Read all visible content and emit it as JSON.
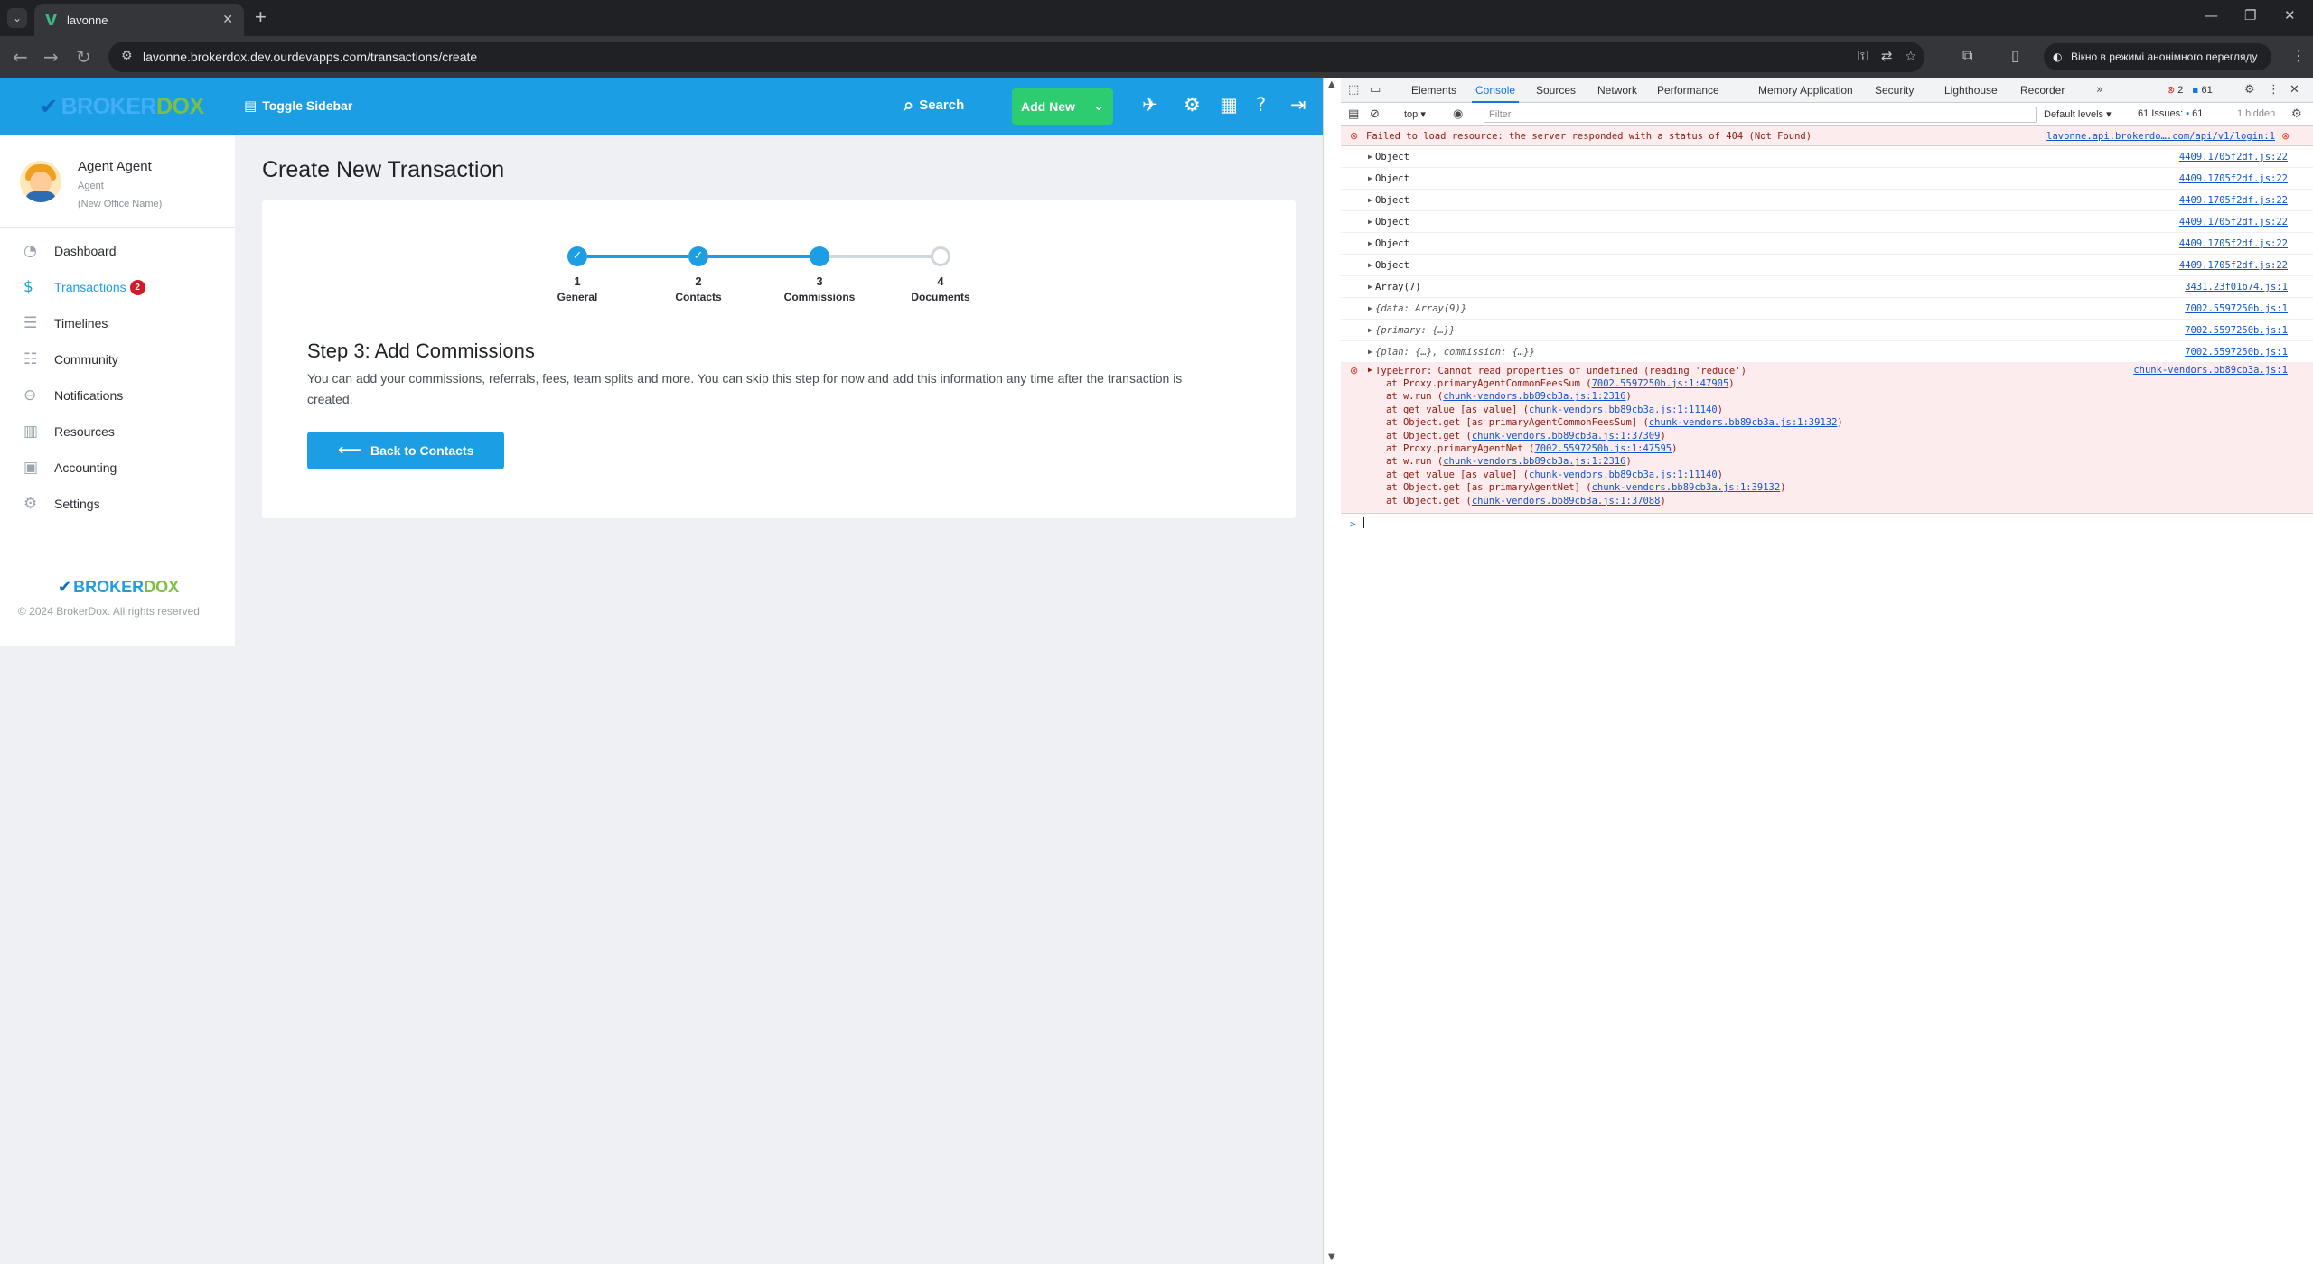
{
  "browser": {
    "tab_title": "lavonne",
    "tab_favicon": "V",
    "tab_close": "✕",
    "new_tab": "+",
    "url": "lavonne.brokerdox.dev.ourdevapps.com/transactions/create",
    "incognito_text": "Вікно в режимі анонімного перегляду"
  },
  "app": {
    "logo_part1": "BROKER",
    "logo_part2": "DOX",
    "toggle_sidebar": "Toggle Sidebar",
    "search": "Search",
    "add_new": "Add New",
    "user": {
      "name": "Agent Agent",
      "role": "Agent",
      "office": "(New Office Name)"
    },
    "menu": [
      {
        "label": "Dashboard",
        "icon": "dashboard-icon"
      },
      {
        "label": "Transactions",
        "icon": "dollar-icon",
        "badge": "2",
        "active": true
      },
      {
        "label": "Timelines",
        "icon": "timeline-icon"
      },
      {
        "label": "Community",
        "icon": "community-icon"
      },
      {
        "label": "Notifications",
        "icon": "notifications-icon"
      },
      {
        "label": "Resources",
        "icon": "resources-icon"
      },
      {
        "label": "Accounting",
        "icon": "accounting-icon"
      },
      {
        "label": "Settings",
        "icon": "settings-icon"
      }
    ],
    "footer_logo_part1": "BROKER",
    "footer_logo_part2": "DOX",
    "copyright": "© 2024 BrokerDox. All rights reserved.",
    "page_title": "Create New Transaction",
    "steps": [
      {
        "num": "1",
        "label": "General",
        "state": "done"
      },
      {
        "num": "2",
        "label": "Contacts",
        "state": "done"
      },
      {
        "num": "3",
        "label": "Commissions",
        "state": "current"
      },
      {
        "num": "4",
        "label": "Documents",
        "state": "todo"
      }
    ],
    "step_title": "Step 3: Add Commissions",
    "step_desc": "You can add your commissions, referrals, fees, team splits and more. You can skip this step for now and add this information any time after the transaction is created.",
    "back_button": "Back to Contacts",
    "colors": {
      "primary": "#1b9ee4",
      "success": "#2ecc71",
      "danger": "#d11a2a"
    }
  },
  "devtools": {
    "tabs": [
      "Elements",
      "Console",
      "Sources",
      "Network",
      "Performance",
      "Memory",
      "Application",
      "Security",
      "Lighthouse",
      "Recorder"
    ],
    "active_tab": "Console",
    "more_tabs": "»",
    "error_count": "2",
    "message_count": "61",
    "context": "top",
    "filter_placeholder": "Filter",
    "levels": "Default levels",
    "issues_label": "61 Issues:",
    "issues_count": "61",
    "hidden": "1 hidden",
    "error1": {
      "text": "Failed to load resource: the server responded with a status of 404 (Not Found)",
      "source": "lavonne.api.brokerdo….com/api/v1/login:1"
    },
    "rows": [
      {
        "text": "Object",
        "source": "4409.1705f2df.js:22",
        "italic": false
      },
      {
        "text": "Object",
        "source": "4409.1705f2df.js:22",
        "italic": false
      },
      {
        "text": "Object",
        "source": "4409.1705f2df.js:22",
        "italic": false
      },
      {
        "text": "Object",
        "source": "4409.1705f2df.js:22",
        "italic": false
      },
      {
        "text": "Object",
        "source": "4409.1705f2df.js:22",
        "italic": false
      },
      {
        "text": "Object",
        "source": "4409.1705f2df.js:22",
        "italic": false
      },
      {
        "text": "Array(7)",
        "source": "3431.23f01b74.js:1",
        "italic": false
      },
      {
        "text": "{data: Array(9)}",
        "source": "7002.5597250b.js:1",
        "italic": true
      },
      {
        "text": "{primary: {…}}",
        "source": "7002.5597250b.js:1",
        "italic": true
      },
      {
        "text": "{plan: {…}, commission: {…}}",
        "source": "7002.5597250b.js:1",
        "italic": true
      }
    ],
    "error2": {
      "text": "TypeError: Cannot read properties of undefined (reading 'reduce')",
      "source": "chunk-vendors.bb89cb3a.js:1",
      "trace": [
        {
          "pre": "at Proxy.primaryAgentCommonFeesSum (",
          "link": "7002.5597250b.js:1:47905",
          "post": ")"
        },
        {
          "pre": "at w.run (",
          "link": "chunk-vendors.bb89cb3a.js:1:2316",
          "post": ")"
        },
        {
          "pre": "at get value [as value] (",
          "link": "chunk-vendors.bb89cb3a.js:1:11140",
          "post": ")"
        },
        {
          "pre": "at Object.get [as primaryAgentCommonFeesSum] (",
          "link": "chunk-vendors.bb89cb3a.js:1:39132",
          "post": ")"
        },
        {
          "pre": "at Object.get (",
          "link": "chunk-vendors.bb89cb3a.js:1:37309",
          "post": ")"
        },
        {
          "pre": "at Proxy.primaryAgentNet (",
          "link": "7002.5597250b.js:1:47595",
          "post": ")"
        },
        {
          "pre": "at w.run (",
          "link": "chunk-vendors.bb89cb3a.js:1:2316",
          "post": ")"
        },
        {
          "pre": "at get value [as value] (",
          "link": "chunk-vendors.bb89cb3a.js:1:11140",
          "post": ")"
        },
        {
          "pre": "at Object.get [as primaryAgentNet] (",
          "link": "chunk-vendors.bb89cb3a.js:1:39132",
          "post": ")"
        },
        {
          "pre": "at Object.get (",
          "link": "chunk-vendors.bb89cb3a.js:1:37088",
          "post": ")"
        }
      ]
    },
    "prompt": ">"
  }
}
